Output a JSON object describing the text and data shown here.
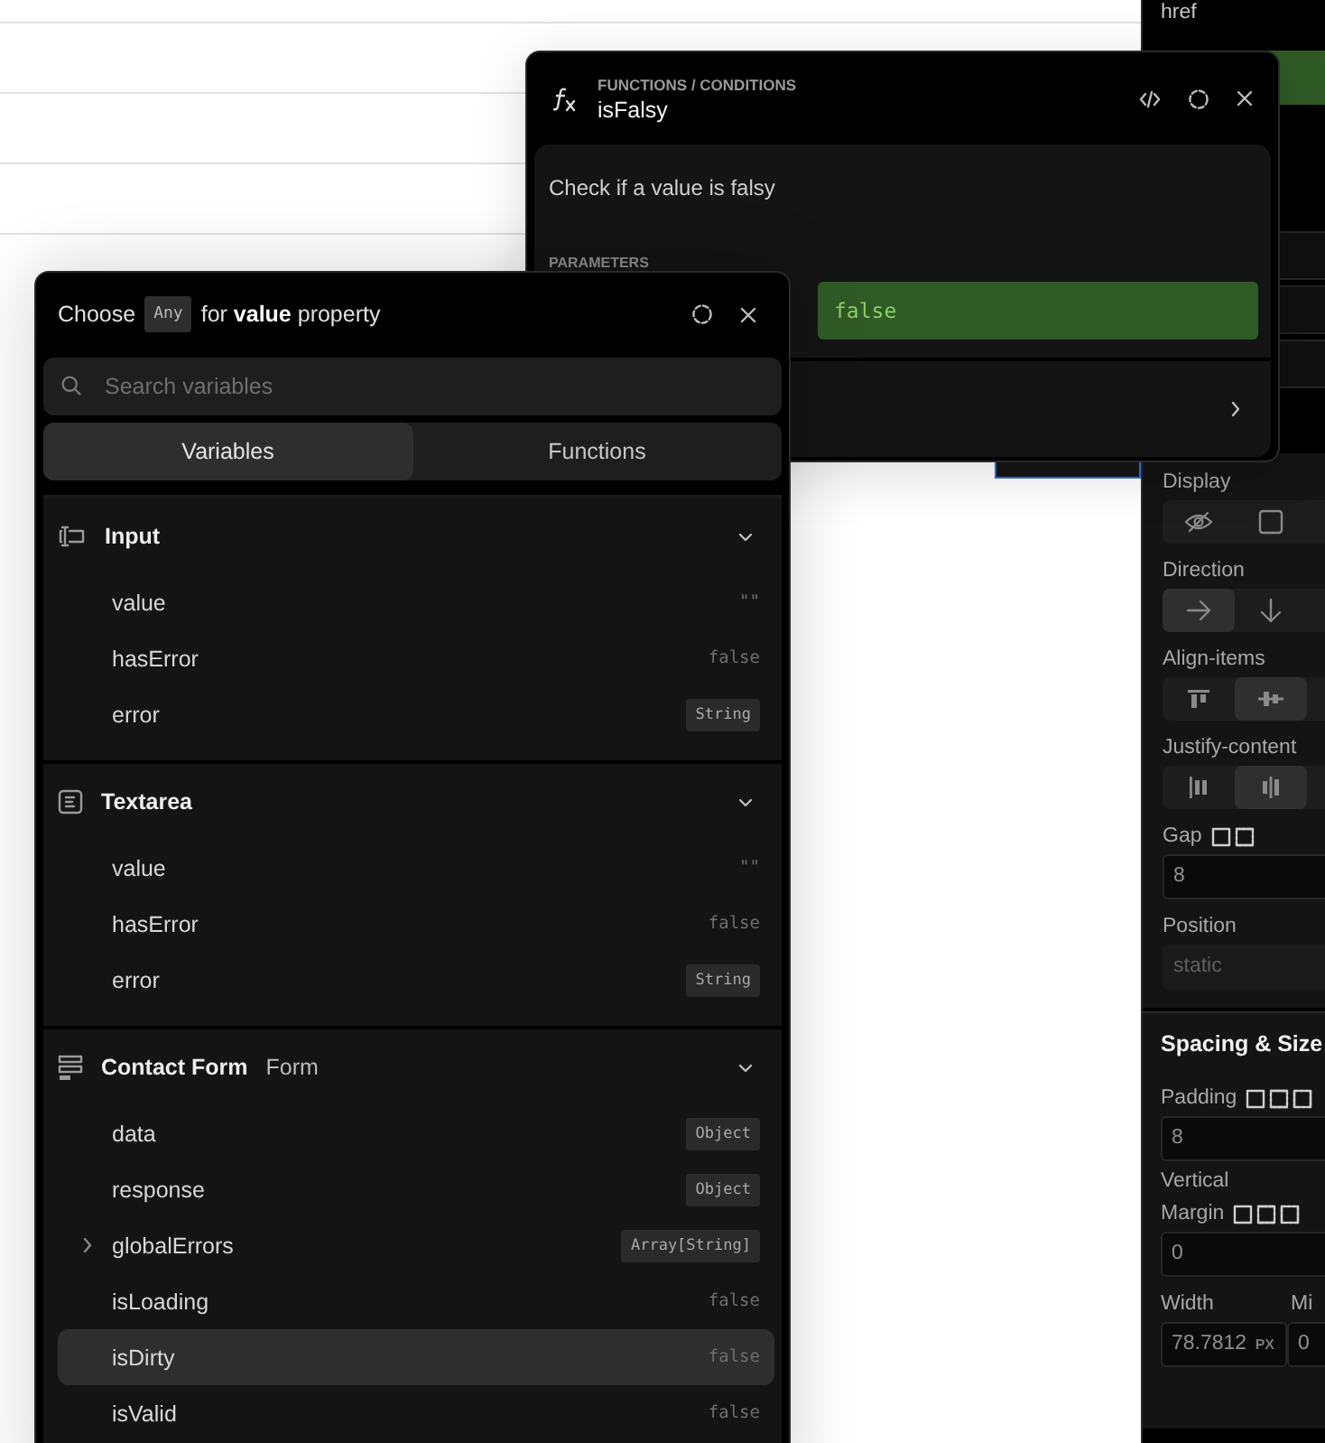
{
  "properties_panel": {
    "href_label": "href",
    "display": {
      "label": "Display",
      "options": [
        {
          "kind": "eye-off",
          "selected": false
        },
        {
          "kind": "square",
          "selected": false
        }
      ]
    },
    "direction": {
      "label": "Direction",
      "options": [
        {
          "kind": "arrow-right",
          "selected": true
        },
        {
          "kind": "arrow-down",
          "selected": false
        }
      ]
    },
    "align_items": {
      "label": "Align-items",
      "options": [
        {
          "kind": "align-top",
          "selected": false
        },
        {
          "kind": "align-center",
          "selected": true
        }
      ]
    },
    "justify_content": {
      "label": "Justify-content",
      "options": [
        {
          "kind": "justify-start",
          "selected": false
        },
        {
          "kind": "justify-center",
          "selected": true
        }
      ]
    },
    "gap": {
      "label": "Gap",
      "value": "8"
    },
    "position": {
      "label": "Position",
      "value": "static",
      "disabled": true
    },
    "section_title": "Spacing & Size",
    "padding": {
      "label": "Padding",
      "value": "8"
    },
    "padding_mode": "Vertical",
    "margin": {
      "label": "Margin",
      "value": "0"
    },
    "width": {
      "label": "Width",
      "value": "78.7812",
      "unit": "PX"
    },
    "min_width": {
      "label": "Mi",
      "value": "0"
    }
  },
  "function_popup": {
    "breadcrumb": "FUNCTIONS / CONDITIONS",
    "title": "isFalsy",
    "description": "Check if a value is falsy",
    "parameters_label": "PARAMETERS",
    "parameter_value": "false"
  },
  "variable_picker": {
    "prefix": "Choose",
    "type": "Any",
    "suffix": "for **value** property",
    "search": {
      "placeholder": "Search variables"
    },
    "tabs": [
      {
        "label": "Variables",
        "selected": true
      },
      {
        "label": "Functions",
        "selected": false
      }
    ],
    "sections": [
      {
        "kind": "input",
        "title": "Input",
        "expanded": true,
        "items": [
          {
            "name": "value",
            "value": "\"\"",
            "kind": "text",
            "expandable": false,
            "selected": false
          },
          {
            "name": "hasError",
            "value": "false",
            "kind": "text",
            "expandable": false,
            "selected": false
          },
          {
            "name": "error",
            "value": "String",
            "kind": "type",
            "expandable": false,
            "selected": false
          }
        ]
      },
      {
        "kind": "textarea",
        "title": "Textarea",
        "expanded": true,
        "items": [
          {
            "name": "value",
            "value": "\"\"",
            "kind": "text",
            "expandable": false,
            "selected": false
          },
          {
            "name": "hasError",
            "value": "false",
            "kind": "text",
            "expandable": false,
            "selected": false
          },
          {
            "name": "error",
            "value": "String",
            "kind": "type",
            "expandable": false,
            "selected": false
          }
        ]
      },
      {
        "kind": "form",
        "title": "Contact Form",
        "subtitle": "Form",
        "expanded": true,
        "items": [
          {
            "name": "data",
            "value": "Object",
            "kind": "type",
            "expandable": false,
            "selected": false
          },
          {
            "name": "response",
            "value": "Object",
            "kind": "type",
            "expandable": false,
            "selected": false
          },
          {
            "name": "globalErrors",
            "value": "Array[String]",
            "kind": "type",
            "expandable": true,
            "selected": false
          },
          {
            "name": "isLoading",
            "value": "false",
            "kind": "text",
            "expandable": false,
            "selected": false
          },
          {
            "name": "isDirty",
            "value": "false",
            "kind": "text",
            "expandable": false,
            "selected": true
          },
          {
            "name": "isValid",
            "value": "false",
            "kind": "text",
            "expandable": false,
            "selected": false
          }
        ]
      }
    ]
  }
}
